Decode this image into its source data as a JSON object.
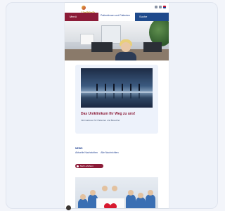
{
  "header": {
    "logo_text": "Uniklinik",
    "nav_left_label": "Menü",
    "nav_mid_text": "Patientinnen und Patienten",
    "nav_right_label": "Suche"
  },
  "feature": {
    "title": "Das Uniklinikum Ihr Weg zu uns!",
    "subtitle": "Informationen für Patienten und Besucher"
  },
  "news": {
    "label": "NEWS",
    "link_1": "Aktuelle Nachrichten",
    "link_2": "Alle Nachrichten"
  },
  "button": {
    "label": "Mehr erfahren"
  },
  "colors": {
    "brand_red": "#8c1c38",
    "brand_blue": "#1f4a8c",
    "feature_bg": "#edf2fb"
  }
}
